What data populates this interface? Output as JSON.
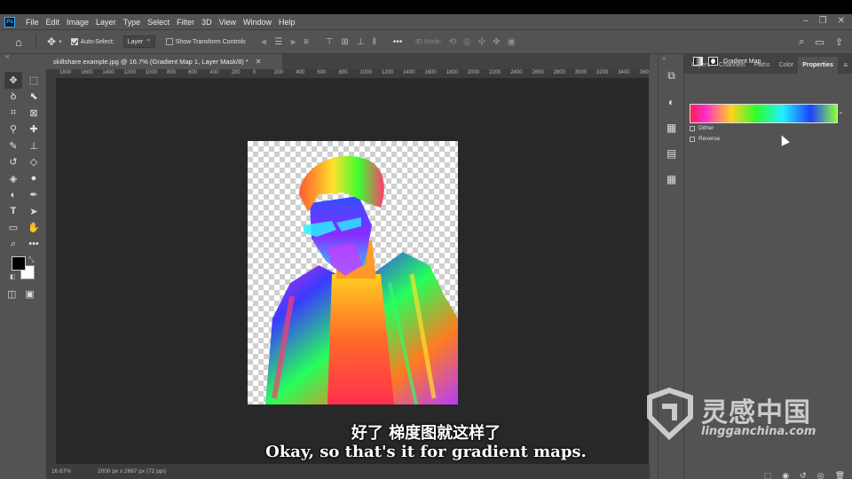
{
  "app": {
    "logo": "Ps"
  },
  "menu": [
    "File",
    "Edit",
    "Image",
    "Layer",
    "Type",
    "Select",
    "Filter",
    "3D",
    "View",
    "Window",
    "Help"
  ],
  "options": {
    "auto_select_label": "Auto-Select:",
    "auto_select_checked": true,
    "target_value": "Layer",
    "transform_label": "Show Transform Controls",
    "transform_checked": false,
    "mode_3d": "3D Mode:"
  },
  "document": {
    "tab_title": "skillshare example.jpg @ 16.7% (Gradient Map 1, Layer Mask/8) *",
    "ruler_ticks": [
      "1800",
      "1600",
      "1400",
      "1200",
      "1000",
      "800",
      "600",
      "400",
      "200",
      "0",
      "200",
      "400",
      "600",
      "800",
      "1000",
      "1200",
      "1400",
      "1600",
      "1800",
      "2000",
      "2200",
      "2400",
      "2600",
      "2800",
      "3000",
      "3200",
      "3400",
      "3600"
    ],
    "zoom": "16.67%",
    "doc_info": "2000 px x 2667 px (72 ppi)"
  },
  "panels": {
    "tabs": [
      "Layers",
      "Channels",
      "Paths",
      "Color",
      "Properties"
    ],
    "active_tab": "Properties"
  },
  "properties": {
    "title": "Gradient Map",
    "dither_label": "Dither",
    "reverse_label": "Reverse",
    "dither_checked": false,
    "reverse_checked": false
  },
  "subtitles": {
    "chinese": "好了 梯度图就这样了",
    "english": "Okay, so that's it for gradient maps."
  },
  "watermark": {
    "chinese": "灵感中国",
    "domain": "lingganchina.com"
  },
  "colors": {
    "foreground": "#000000",
    "background": "#ffffff",
    "ui_panel": "#535353",
    "canvas": "#282828"
  }
}
